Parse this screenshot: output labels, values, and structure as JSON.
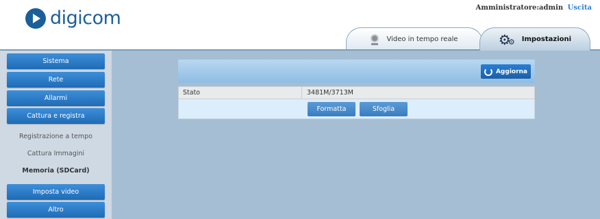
{
  "brand": {
    "name": "digicom"
  },
  "user_bar": {
    "user": "Amministratore:admin",
    "logout": "Uscita"
  },
  "tabs": [
    {
      "label": "Video in tempo reale",
      "icon": "camera-icon",
      "active": false
    },
    {
      "label": "Impostazioni",
      "icon": "gear-icon",
      "active": true
    }
  ],
  "sidebar": {
    "items": [
      {
        "label": "Sistema",
        "type": "button"
      },
      {
        "label": "Rete",
        "type": "button"
      },
      {
        "label": "Allarmi",
        "type": "button"
      },
      {
        "label": "Cattura e registra",
        "type": "button"
      },
      {
        "label": "Registrazione a tempo",
        "type": "sub"
      },
      {
        "label": "Cattura Immagini",
        "type": "sub"
      },
      {
        "label": "Memoria (SDCard)",
        "type": "sub",
        "active": true
      },
      {
        "label": "Imposta video",
        "type": "button"
      },
      {
        "label": "Altro",
        "type": "button"
      }
    ]
  },
  "content": {
    "refresh_label": "Aggiorna",
    "status_label": "Stato",
    "status_value": "3481M/3713M",
    "format_label": "Formatta",
    "browse_label": "Sfoglia"
  },
  "colors": {
    "accent": "#2b7ed1",
    "background": "#a5bed4",
    "sidebar": "#ced9e4",
    "brand": "#1b5f9a"
  }
}
